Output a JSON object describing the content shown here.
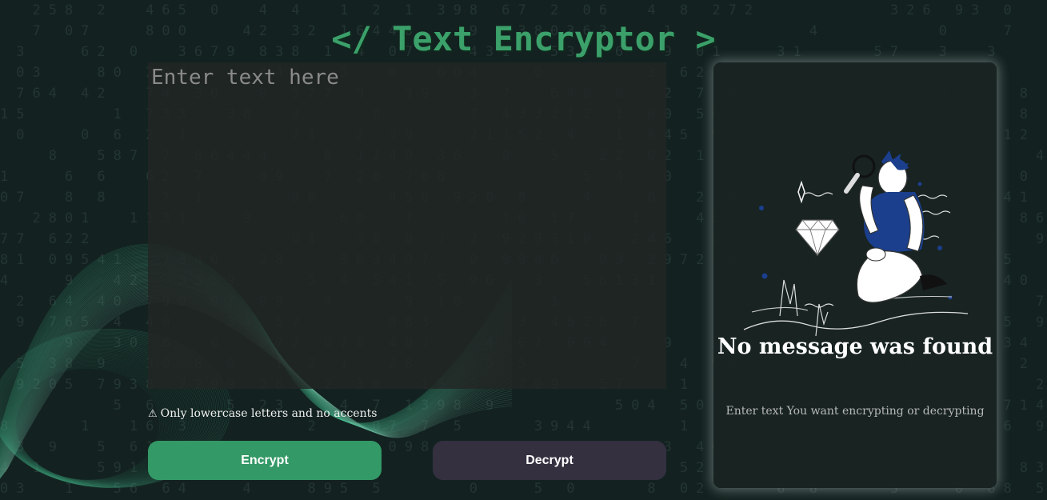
{
  "header": {
    "title": "</ Text Encryptor >"
  },
  "editor": {
    "placeholder": "Enter text here",
    "value": ""
  },
  "warning": {
    "icon": "warning-icon",
    "text": "Only lowercase letters and no accents"
  },
  "actions": {
    "encrypt_label": "Encrypt",
    "decrypt_label": "Decrypt"
  },
  "output": {
    "title": "No message was found",
    "subtitle": "Enter text You want encrypting or decrypting"
  },
  "colors": {
    "background": "#132220",
    "accent": "#339966",
    "title": "#3ba06a",
    "secondary_button": "#343040"
  }
}
